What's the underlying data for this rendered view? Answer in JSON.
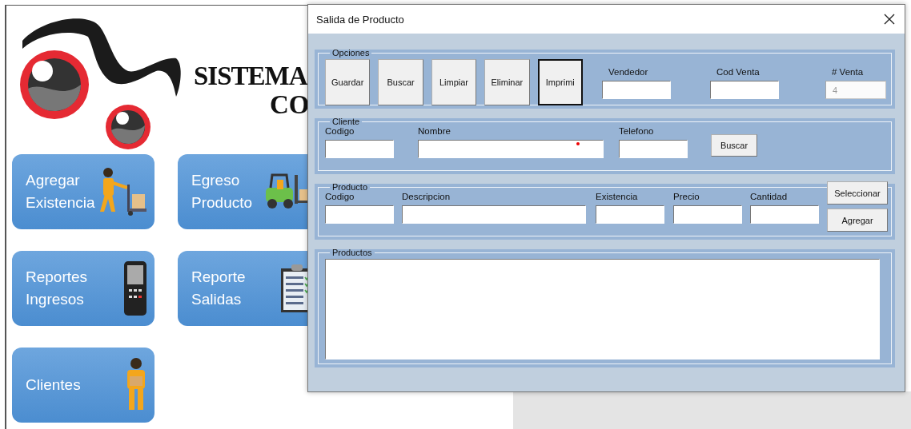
{
  "logo": {
    "line_1": "SISTEMA",
    "line_2": "CO"
  },
  "tiles": [
    {
      "lines": [
        "Agregar",
        "Existencia"
      ],
      "kind": "cart"
    },
    {
      "lines": [
        "Egreso",
        "Producto"
      ],
      "kind": "forklift"
    },
    {
      "lines": [
        "Reportes",
        "Ingresos"
      ],
      "kind": "scanner"
    },
    {
      "lines": [
        "Reporte",
        "Salidas"
      ],
      "kind": "clipboard"
    },
    {
      "lines": [
        "Clientes"
      ],
      "kind": "worker"
    }
  ],
  "dialog": {
    "title": "Salida de Producto",
    "options": {
      "legend": "Opciones",
      "buttons": [
        {
          "label": "Guardar",
          "focused": false
        },
        {
          "label": "Buscar",
          "focused": false
        },
        {
          "label": "Limpiar",
          "focused": false
        },
        {
          "label": "Eliminar",
          "focused": false
        },
        {
          "label": "Imprimi",
          "focused": true
        }
      ],
      "fields": [
        {
          "label": "Vendedor",
          "disabled": false
        },
        {
          "label": "Cod Venta",
          "disabled": false
        },
        {
          "label": "# Venta",
          "value": "4",
          "disabled": true
        }
      ]
    },
    "cliente": {
      "legend": "Cliente",
      "fields": [
        {
          "label": "Codigo"
        },
        {
          "label": "Nombre"
        },
        {
          "label": "Telefono"
        }
      ],
      "button": "Buscar"
    },
    "producto": {
      "legend": "Producto",
      "fields": [
        {
          "label": "Codigo"
        },
        {
          "label": "Descripcion"
        },
        {
          "label": "Existencia"
        },
        {
          "label": "Precio"
        },
        {
          "label": "Cantidad"
        }
      ],
      "buttons": [
        "Seleccionar",
        "Agregar"
      ]
    },
    "productos": {
      "legend": "Productos"
    }
  }
}
